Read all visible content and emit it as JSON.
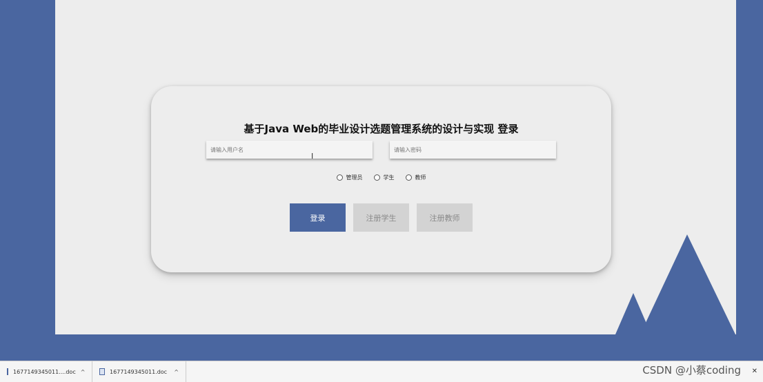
{
  "form": {
    "title": "基于Java Web的毕业设计选题管理系统的设计与实现 登录",
    "username_placeholder": "请输入用户名",
    "password_placeholder": "请输入密码",
    "roles": [
      {
        "label": "管理员"
      },
      {
        "label": "学生"
      },
      {
        "label": "教师"
      }
    ],
    "buttons": {
      "login": "登录",
      "register_student": "注册学生",
      "register_teacher": "注册教师"
    }
  },
  "download_bar": {
    "items": [
      {
        "name": "1677149345011....doc"
      },
      {
        "name": "1677149345011.doc"
      }
    ]
  },
  "watermark": "CSDN @小蔡coding",
  "colors": {
    "brand_blue": "#4a66a0",
    "page_bg": "#ededed",
    "disabled_button": "#d3d3d3"
  },
  "icons": {
    "document": "doc-icon",
    "chevron": "chevron-up-icon",
    "close": "close-icon"
  }
}
